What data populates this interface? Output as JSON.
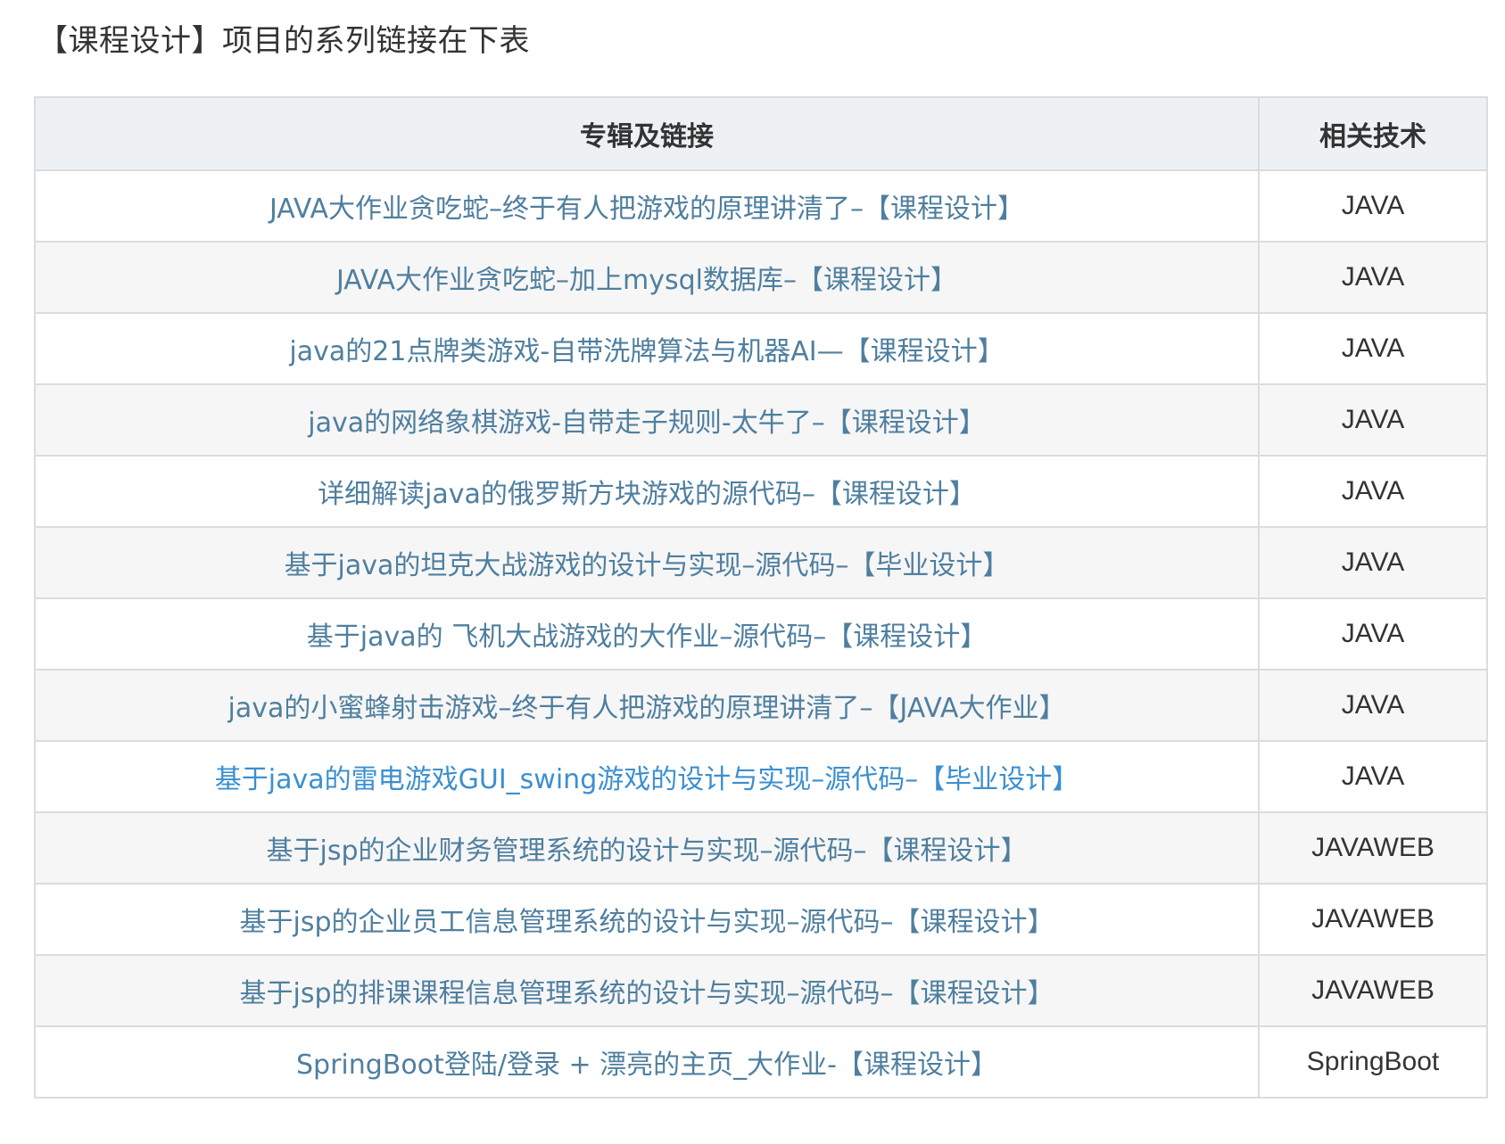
{
  "intro": "【课程设计】项目的系列链接在下表",
  "table": {
    "headers": {
      "album": "专辑及链接",
      "tech": "相关技术"
    },
    "rows": [
      {
        "title": "JAVA大作业贪吃蛇–终于有人把游戏的原理讲清了–【课程设计】",
        "tech": "JAVA"
      },
      {
        "title": "JAVA大作业贪吃蛇–加上mysql数据库–【课程设计】",
        "tech": "JAVA"
      },
      {
        "title": "java的21点牌类游戏-自带洗牌算法与机器AI—【课程设计】",
        "tech": "JAVA"
      },
      {
        "title": "java的网络象棋游戏-自带走子规则-太牛了–【课程设计】",
        "tech": "JAVA"
      },
      {
        "title": "详细解读java的俄罗斯方块游戏的源代码–【课程设计】",
        "tech": "JAVA"
      },
      {
        "title": "基于java的坦克大战游戏的设计与实现–源代码–【毕业设计】",
        "tech": "JAVA"
      },
      {
        "title": "基于java的 飞机大战游戏的大作业–源代码–【课程设计】",
        "tech": "JAVA"
      },
      {
        "title": "java的小蜜蜂射击游戏–终于有人把游戏的原理讲清了–【JAVA大作业】",
        "tech": "JAVA"
      },
      {
        "title": "基于java的雷电游戏GUI_swing游戏的设计与实现–源代码–【毕业设计】",
        "tech": "JAVA"
      },
      {
        "title": "基于jsp的企业财务管理系统的设计与实现–源代码–【课程设计】",
        "tech": "JAVAWEB"
      },
      {
        "title": "基于jsp的企业员工信息管理系统的设计与实现–源代码–【课程设计】",
        "tech": "JAVAWEB"
      },
      {
        "title": "基于jsp的排课课程信息管理系统的设计与实现–源代码–【课程设计】",
        "tech": "JAVAWEB"
      },
      {
        "title": "SpringBoot登陆/登录 + 漂亮的主页_大作业-【课程设计】",
        "tech": "SpringBoot"
      }
    ]
  }
}
